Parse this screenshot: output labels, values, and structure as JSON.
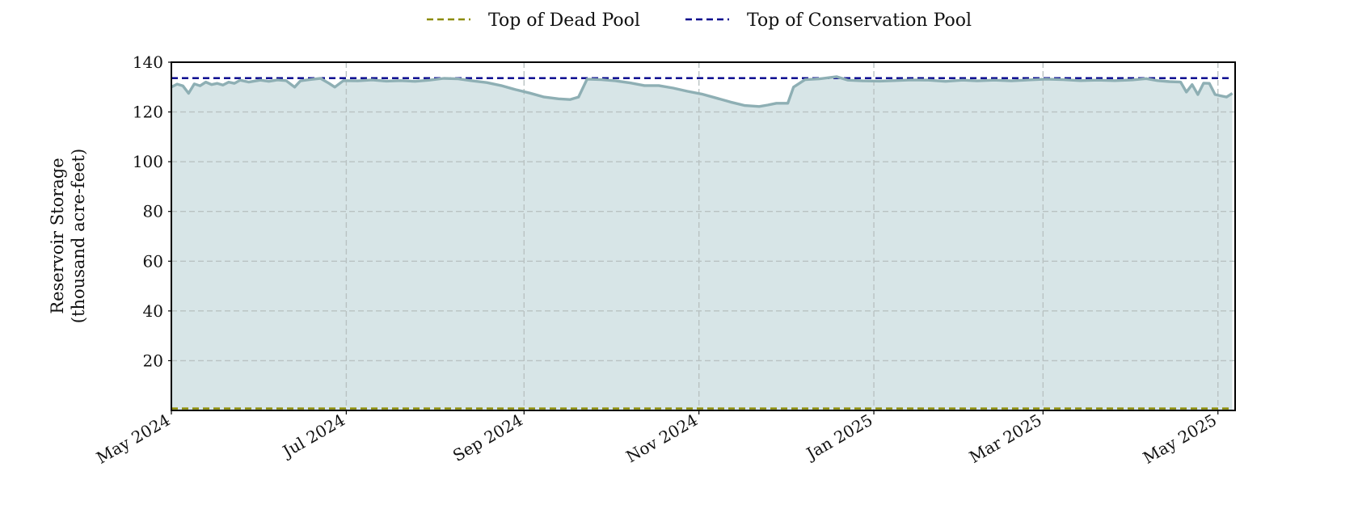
{
  "chart_data": {
    "type": "area",
    "title": "",
    "ylabel": [
      "Reservoir Storage",
      "(thousand acre-feet)"
    ],
    "xlabel": "",
    "xlim": [
      "2024-05-01",
      "2025-05-07"
    ],
    "ylim": [
      0,
      140
    ],
    "y_ticks": [
      20,
      40,
      60,
      80,
      100,
      120,
      140
    ],
    "x_ticks": [
      {
        "date": "2024-05-01",
        "label": "May 2024"
      },
      {
        "date": "2024-07-01",
        "label": "Jul 2024"
      },
      {
        "date": "2024-09-01",
        "label": "Sep 2024"
      },
      {
        "date": "2024-11-01",
        "label": "Nov 2024"
      },
      {
        "date": "2025-01-01",
        "label": "Jan 2025"
      },
      {
        "date": "2025-03-01",
        "label": "Mar 2025"
      },
      {
        "date": "2025-05-01",
        "label": "May 2025"
      }
    ],
    "grid": true,
    "legend_placement": "top-center",
    "reference_lines": [
      {
        "name": "Top of Dead Pool",
        "y": 0.8,
        "color": "#8b8b00",
        "style": "dashed"
      },
      {
        "name": "Top of Conservation Pool",
        "y": 133.6,
        "color": "#00008b",
        "style": "dashed"
      }
    ],
    "series": [
      {
        "color": "#8eafb4",
        "fill": "#d7e5e7",
        "points": [
          [
            "2024-05-01",
            130.0
          ],
          [
            "2024-05-03",
            131.2
          ],
          [
            "2024-05-05",
            130.5
          ],
          [
            "2024-05-07",
            127.5
          ],
          [
            "2024-05-09",
            131.3
          ],
          [
            "2024-05-11",
            130.5
          ],
          [
            "2024-05-13",
            132.0
          ],
          [
            "2024-05-15",
            131.0
          ],
          [
            "2024-05-17",
            131.5
          ],
          [
            "2024-05-19",
            130.8
          ],
          [
            "2024-05-21",
            132.0
          ],
          [
            "2024-05-23",
            131.5
          ],
          [
            "2024-05-25",
            132.8
          ],
          [
            "2024-05-28",
            132.0
          ],
          [
            "2024-06-01",
            132.8
          ],
          [
            "2024-06-04",
            132.3
          ],
          [
            "2024-06-07",
            132.9
          ],
          [
            "2024-06-10",
            132.6
          ],
          [
            "2024-06-13",
            130.0
          ],
          [
            "2024-06-15",
            132.5
          ],
          [
            "2024-06-19",
            133.1
          ],
          [
            "2024-06-22",
            133.5
          ],
          [
            "2024-06-25",
            131.5
          ],
          [
            "2024-06-27",
            130.0
          ],
          [
            "2024-06-30",
            132.6
          ],
          [
            "2024-07-05",
            132.5
          ],
          [
            "2024-07-10",
            132.9
          ],
          [
            "2024-07-15",
            132.4
          ],
          [
            "2024-07-20",
            132.6
          ],
          [
            "2024-07-25",
            132.3
          ],
          [
            "2024-07-30",
            132.8
          ],
          [
            "2024-08-04",
            133.5
          ],
          [
            "2024-08-09",
            133.3
          ],
          [
            "2024-08-14",
            132.5
          ],
          [
            "2024-08-19",
            131.8
          ],
          [
            "2024-08-24",
            130.6
          ],
          [
            "2024-08-29",
            129.0
          ],
          [
            "2024-09-03",
            127.6
          ],
          [
            "2024-09-08",
            126.0
          ],
          [
            "2024-09-13",
            125.3
          ],
          [
            "2024-09-17",
            125.0
          ],
          [
            "2024-09-20",
            126.0
          ],
          [
            "2024-09-23",
            133.2
          ],
          [
            "2024-09-28",
            133.0
          ],
          [
            "2024-10-03",
            132.5
          ],
          [
            "2024-10-08",
            131.7
          ],
          [
            "2024-10-13",
            130.6
          ],
          [
            "2024-10-18",
            130.6
          ],
          [
            "2024-10-23",
            129.6
          ],
          [
            "2024-10-28",
            128.3
          ],
          [
            "2024-11-02",
            127.2
          ],
          [
            "2024-11-07",
            125.6
          ],
          [
            "2024-11-12",
            124.0
          ],
          [
            "2024-11-17",
            122.6
          ],
          [
            "2024-11-22",
            122.2
          ],
          [
            "2024-11-25",
            122.8
          ],
          [
            "2024-11-28",
            123.5
          ],
          [
            "2024-12-02",
            123.5
          ],
          [
            "2024-12-04",
            130.0
          ],
          [
            "2024-12-08",
            133.0
          ],
          [
            "2024-12-13",
            133.3
          ],
          [
            "2024-12-19",
            134.2
          ],
          [
            "2024-12-23",
            132.8
          ],
          [
            "2024-12-28",
            132.5
          ],
          [
            "2025-01-03",
            132.4
          ],
          [
            "2025-01-08",
            132.6
          ],
          [
            "2025-01-14",
            132.9
          ],
          [
            "2025-01-20",
            132.8
          ],
          [
            "2025-01-26",
            132.3
          ],
          [
            "2025-02-01",
            132.8
          ],
          [
            "2025-02-06",
            132.5
          ],
          [
            "2025-02-12",
            132.8
          ],
          [
            "2025-02-18",
            132.5
          ],
          [
            "2025-02-24",
            132.9
          ],
          [
            "2025-03-02",
            133.2
          ],
          [
            "2025-03-08",
            133.0
          ],
          [
            "2025-03-14",
            132.6
          ],
          [
            "2025-03-20",
            132.8
          ],
          [
            "2025-03-26",
            132.6
          ],
          [
            "2025-04-01",
            132.9
          ],
          [
            "2025-04-06",
            133.4
          ],
          [
            "2025-04-10",
            132.6
          ],
          [
            "2025-04-14",
            132.2
          ],
          [
            "2025-04-18",
            132.0
          ],
          [
            "2025-04-20",
            128.0
          ],
          [
            "2025-04-22",
            131.0
          ],
          [
            "2025-04-24",
            127.0
          ],
          [
            "2025-04-26",
            131.6
          ],
          [
            "2025-04-28",
            131.5
          ],
          [
            "2025-04-30",
            127.0
          ],
          [
            "2025-05-02",
            126.5
          ],
          [
            "2025-05-04",
            126.0
          ],
          [
            "2025-05-06",
            127.5
          ]
        ]
      }
    ]
  }
}
